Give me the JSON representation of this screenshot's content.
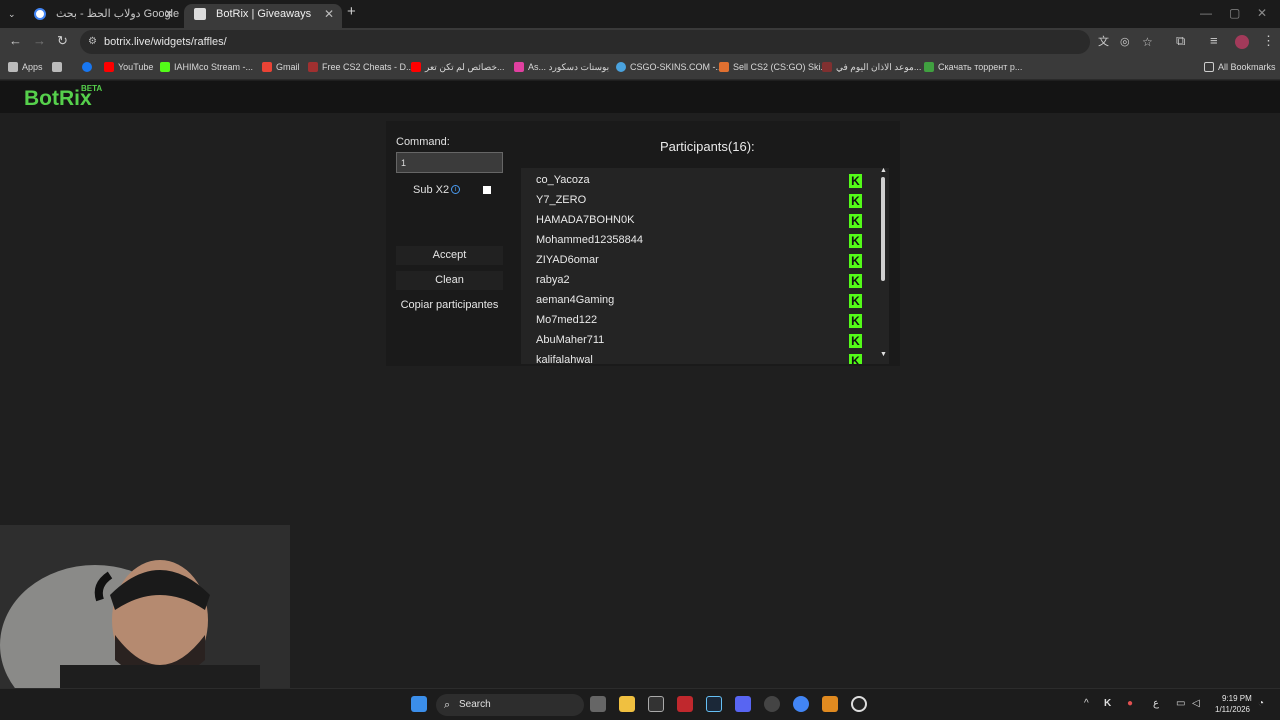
{
  "browser": {
    "tabs": [
      {
        "title": "دولاب الحظ - بحث Google",
        "active": false
      },
      {
        "title": "BotRix | Giveaways",
        "active": true
      }
    ],
    "new_tab": "+",
    "url": "botrix.live/widgets/raffles/",
    "bookmarks": [
      {
        "label": "Apps",
        "icon": "apps-icon",
        "color": "#bbbbbb"
      },
      {
        "label": "",
        "icon": "grid-icon",
        "color": "#bbbbbb"
      },
      {
        "label": "",
        "icon": "facebook-icon",
        "color": "#1877f2"
      },
      {
        "label": "YouTube",
        "icon": "youtube-icon",
        "color": "#ff0000"
      },
      {
        "label": "IAHIMco Stream -...",
        "icon": "kick-icon",
        "color": "#53fc18"
      },
      {
        "label": "Gmail",
        "icon": "gmail-icon",
        "color": "#ea4335"
      },
      {
        "label": "Free CS2 Cheats - D...",
        "icon": "cheat-icon",
        "color": "#a03030"
      },
      {
        "label": "خصائص لم تكن تعر...",
        "icon": "youtube-icon",
        "color": "#ff0000"
      },
      {
        "label": "As... بوستات دسكورد",
        "icon": "gem-icon",
        "color": "#e040a0"
      },
      {
        "label": "CSGO-SKINS.COM -...",
        "icon": "csgo-icon",
        "color": "#4aa3df"
      },
      {
        "label": "Sell CS2 (CS:GO) Ski...",
        "icon": "skin-icon",
        "color": "#e07030"
      },
      {
        "label": "موعد الاذان اليوم في...",
        "icon": "mosque-icon",
        "color": "#803030"
      },
      {
        "label": "Скачать торрент р...",
        "icon": "torrent-icon",
        "color": "#40a040"
      }
    ],
    "all_bookmarks": "All Bookmarks"
  },
  "site": {
    "logo": "BotRix",
    "logo_badge": "BETA"
  },
  "widget": {
    "command_label": "Command:",
    "command_value": "1",
    "sub_x2_label": "Sub X2",
    "sub_x2_checked": false,
    "accept_label": "Accept",
    "clean_label": "Clean",
    "copy_label": "Copiar participantes",
    "participants_title": "Participants(16):",
    "participants": [
      "co_Yacoza",
      "Y7_ZERO",
      "HAMADA7BOHN0K",
      "Mohammed12358844",
      "ZIYAD6omar",
      "rabya2",
      "aeman4Gaming",
      "Mo7med122",
      "AbuMaher711",
      "kalifalahwal"
    ],
    "platform_badge": "K",
    "platform_color": "#53fc18"
  },
  "taskbar": {
    "search_label": "Search",
    "time": "9:19 PM",
    "date": "1/11/2026",
    "lang": "ع"
  }
}
